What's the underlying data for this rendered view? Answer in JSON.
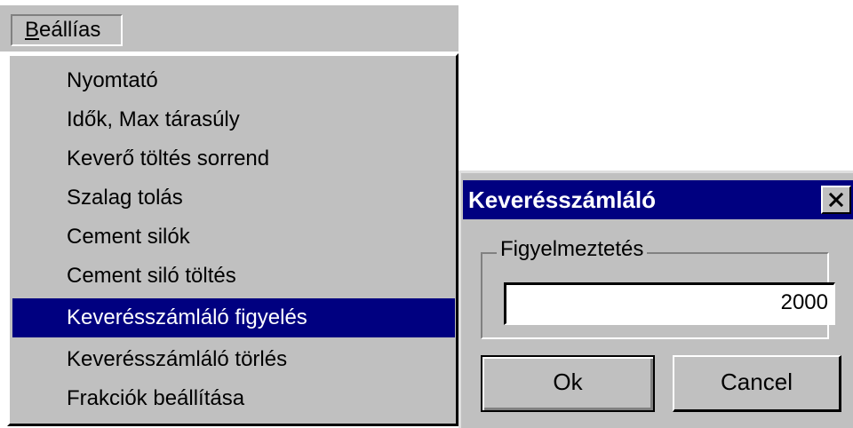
{
  "menubar": {
    "items": [
      {
        "label_underlined": "B",
        "label_rest": "eállías"
      }
    ]
  },
  "dropdown": {
    "items": [
      {
        "label": "Nyomtató",
        "selected": false
      },
      {
        "label": "Idők, Max tárasúly",
        "selected": false
      },
      {
        "label": "Keverő töltés sorrend",
        "selected": false
      },
      {
        "label": "Szalag tolás",
        "selected": false
      },
      {
        "label": "Cement silók",
        "selected": false
      },
      {
        "label": "Cement siló töltés",
        "selected": false
      },
      {
        "label": "Keverésszámláló figyelés",
        "selected": true
      },
      {
        "label": "Keverésszámláló törlés",
        "selected": false
      },
      {
        "label": "Frakciók beállítása",
        "selected": false
      }
    ]
  },
  "dialog": {
    "title": "Keverésszámláló",
    "close_icon": "close-icon",
    "group_label": "Figyelmeztetés",
    "input_value": "2000",
    "ok_label": "Ok",
    "cancel_label": "Cancel"
  },
  "colors": {
    "face": "#c0c0c0",
    "highlight": "#000080",
    "highlight_text": "#ffffff"
  }
}
